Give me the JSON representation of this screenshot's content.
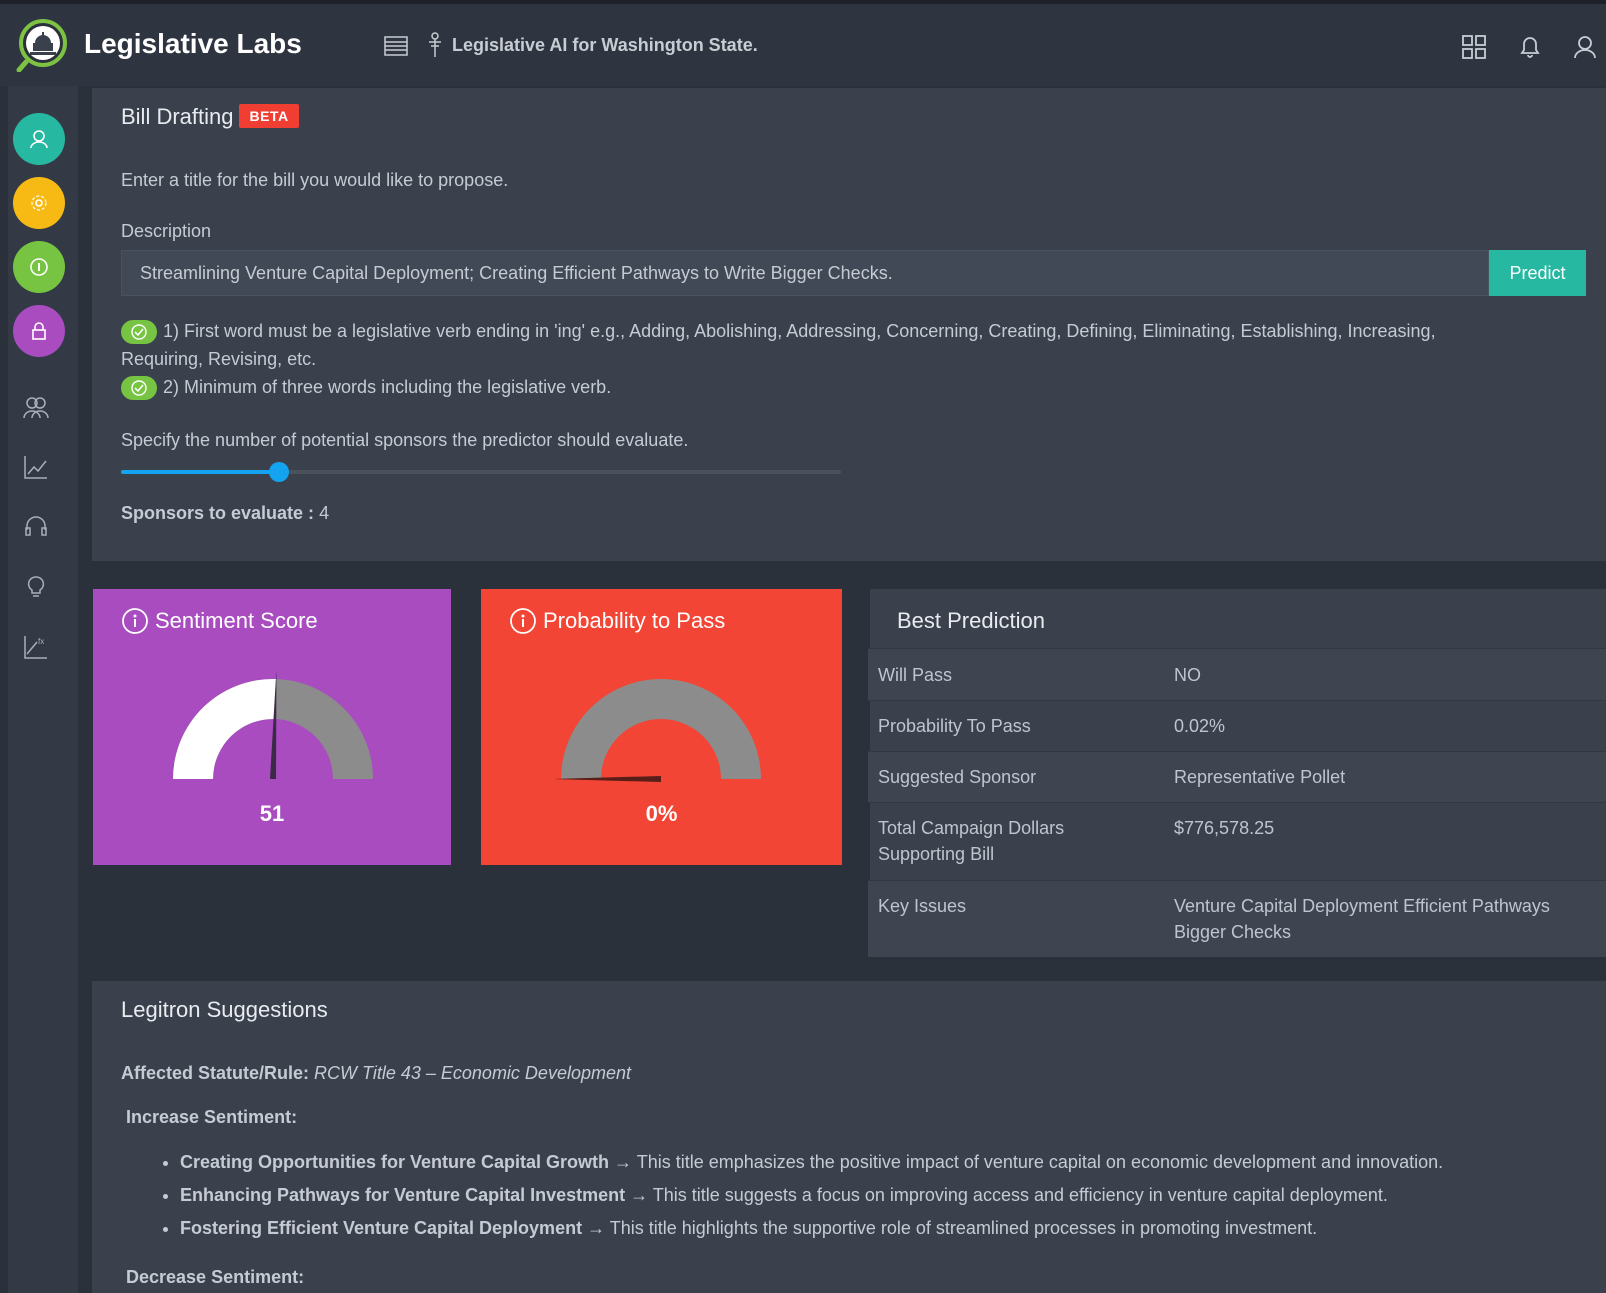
{
  "app": {
    "brand": "Legislative Labs",
    "tagline": "Legislative AI for Washington State."
  },
  "bill": {
    "title": "Bill Drafting",
    "badge": "BETA",
    "instructions": "Enter a title for the bill you would like to propose.",
    "description_label": "Description",
    "description_value": "Streamlining Venture Capital Deployment; Creating Efficient Pathways to Write Bigger Checks.",
    "predict_label": "Predict",
    "rule1_line1": "1) First word must be a legislative verb ending in 'ing' e.g., Adding, Abolishing, Addressing, Concerning, Creating, Defining, Eliminating, Establishing, Increasing,",
    "rule1_line2": "Requiring, Revising, etc.",
    "rule2": "2) Minimum of three words including the legislative verb.",
    "slider_label": "Specify the number of potential sponsors the predictor should evaluate.",
    "slider_fraction": 0.22,
    "sponsors_label": "Sponsors to evaluate :",
    "sponsors_value": "4"
  },
  "sentiment": {
    "title": "Sentiment Score",
    "value": 51,
    "display": "51",
    "color": "#a84cc0"
  },
  "probability": {
    "title": "Probability to Pass",
    "value": 0,
    "display": "0%",
    "color": "#f24535"
  },
  "prediction": {
    "title": "Best Prediction",
    "rows": [
      {
        "label": "Will Pass",
        "value": "NO"
      },
      {
        "label": "Probability To Pass",
        "value": "0.02%"
      },
      {
        "label": "Suggested Sponsor",
        "value": "Representative Pollet"
      },
      {
        "label_line1": "Total Campaign Dollars",
        "label_line2": "Supporting Bill",
        "value": "$776,578.25"
      },
      {
        "label": "Key Issues",
        "value_line1": "Venture Capital Deployment Efficient Pathways",
        "value_line2": "Bigger Checks"
      }
    ]
  },
  "suggestions": {
    "title": "Legitron Suggestions",
    "statute_label": "Affected Statute/Rule:",
    "statute_value": "RCW Title 43 – Economic Development",
    "increase_label": "Increase Sentiment:",
    "items": [
      {
        "title": "Creating Opportunities for Venture Capital Growth",
        "text": " → This title emphasizes the positive impact of venture capital on economic development and innovation."
      },
      {
        "title": "Enhancing Pathways for Venture Capital Investment",
        "text": " → This title suggests a focus on improving access and efficiency in venture capital deployment."
      },
      {
        "title": "Fostering Efficient Venture Capital Deployment",
        "text": " → This title highlights the supportive role of streamlined processes in promoting investment."
      }
    ],
    "decrease_label": "Decrease Sentiment:"
  },
  "icons": {
    "logo": "capitol-magnifier-icon",
    "menu": "menu-lines-icon",
    "tagline": "flag-icon",
    "grid": "grid-icon",
    "bell": "bell-icon",
    "user": "user-icon",
    "sidebar_circles": [
      "user-icon",
      "flower-icon",
      "info-icon",
      "lock-icon"
    ],
    "sidebar_lines": [
      "users-icon",
      "chart-icon",
      "headset-icon",
      "bulb-icon",
      "function-chart-icon"
    ]
  },
  "colors": {
    "teal": "#27b8a1",
    "yellow": "#f7b914",
    "green": "#76c442",
    "purple": "#a84cc0",
    "red": "#f03e33",
    "blue": "#14a3f0"
  }
}
